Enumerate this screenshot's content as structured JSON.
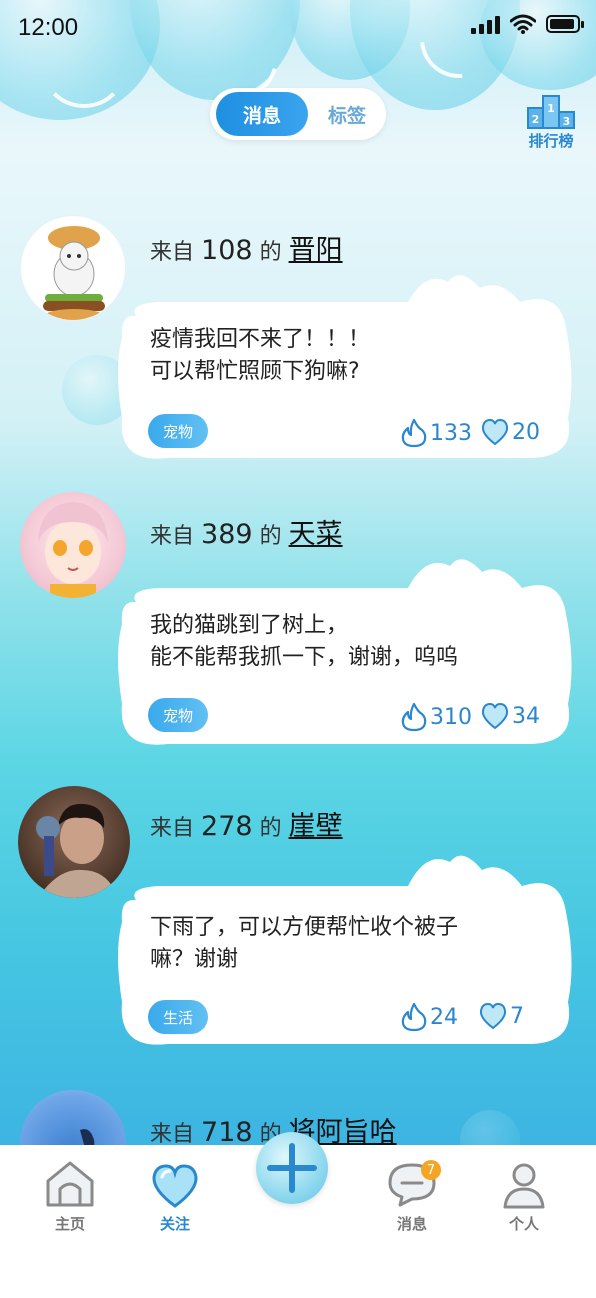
{
  "status": {
    "time": "12:00"
  },
  "header": {
    "tabs": [
      {
        "label": "消息",
        "active": true
      },
      {
        "label": "标签",
        "active": false
      }
    ],
    "ranking_label": "排行榜",
    "ranking_digits": [
      "2",
      "1",
      "3"
    ]
  },
  "posts": [
    {
      "from_prefix": "来自",
      "number": "108",
      "from_mid": "的",
      "name": "晋阳",
      "message": [
        "疫情我回不来了！！！",
        "可以帮忙照顾下狗嘛?"
      ],
      "tag": "宠物",
      "fire_count": "133",
      "heart_count": "20"
    },
    {
      "from_prefix": "来自",
      "number": "389",
      "from_mid": "的",
      "name": "天菜",
      "message": [
        "我的猫跳到了树上，",
        "能不能帮我抓一下，谢谢，呜呜"
      ],
      "tag": "宠物",
      "fire_count": "310",
      "heart_count": "34"
    },
    {
      "from_prefix": "来自",
      "number": "278",
      "from_mid": "的",
      "name": "崖壁",
      "message": [
        "下雨了，可以方便帮忙收个被子",
        "嘛？谢谢"
      ],
      "tag": "生活",
      "fire_count": "24",
      "heart_count": "7"
    },
    {
      "from_prefix": "来自",
      "number": "718",
      "from_mid": "的",
      "name": "将阿旨哈"
    }
  ],
  "tabbar": {
    "items": [
      {
        "label": "主页",
        "icon": "home-icon",
        "active": false
      },
      {
        "label": "关注",
        "icon": "heart-icon",
        "active": true
      },
      {
        "label": "消息",
        "icon": "chat-icon",
        "active": false,
        "badge": "7"
      },
      {
        "label": "个人",
        "icon": "user-icon",
        "active": false
      }
    ],
    "add_icon": "plus-icon"
  },
  "colors": {
    "accent": "#2a88cf",
    "tag": "#3aa9ec",
    "badge": "#f5a524"
  }
}
